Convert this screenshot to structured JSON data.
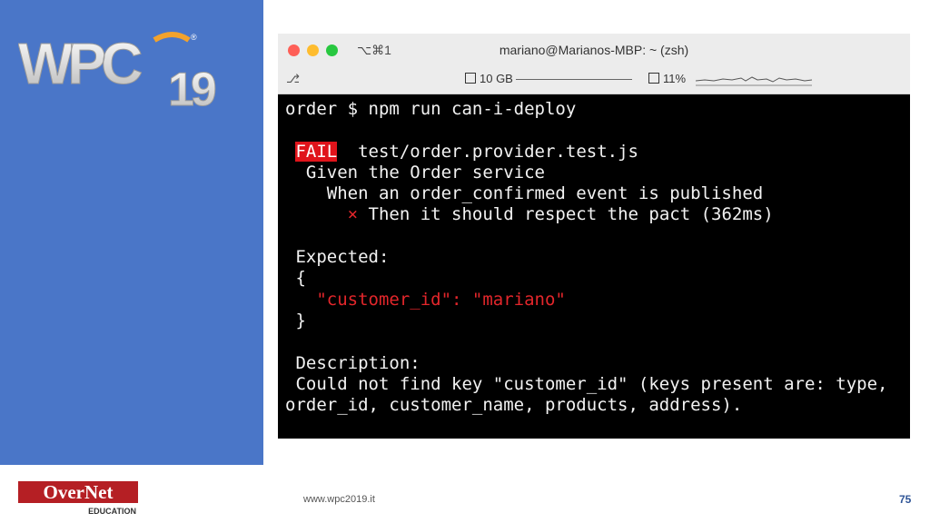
{
  "slide": {
    "logo_text": "WPC19",
    "url": "www.wpc2019.it",
    "page_number": "75",
    "brand_text": "OverNet",
    "brand_subtext": "EDUCATION"
  },
  "terminal": {
    "shortcut": "⌥⌘1",
    "title": "mariano@Marianos-MBP: ~ (zsh)",
    "branch_icon": "⎇",
    "memory": "10 GB",
    "cpu": "11%",
    "lines": {
      "cmd": "order $ npm run can-i-deploy",
      "fail_label": "FAIL",
      "fail_file": "  test/order.provider.test.js",
      "given": "  Given the Order service",
      "when": "    When an order_confirmed event is published",
      "then_mark": "×",
      "then": " Then it should respect the pact (362ms)",
      "expected_label": " Expected:",
      "brace_open": " {",
      "expected_line": "\"customer_id\": \"mariano\"",
      "brace_close": " }",
      "desc_label": " Description:",
      "desc_1": " Could not find key \"customer_id\" (keys present are: type,",
      "desc_2": "order_id, customer_name, products, address)."
    }
  },
  "colors": {
    "sidebar": "#4a76c8",
    "fail_bg": "#e0141b",
    "error_text": "#e3262b"
  }
}
